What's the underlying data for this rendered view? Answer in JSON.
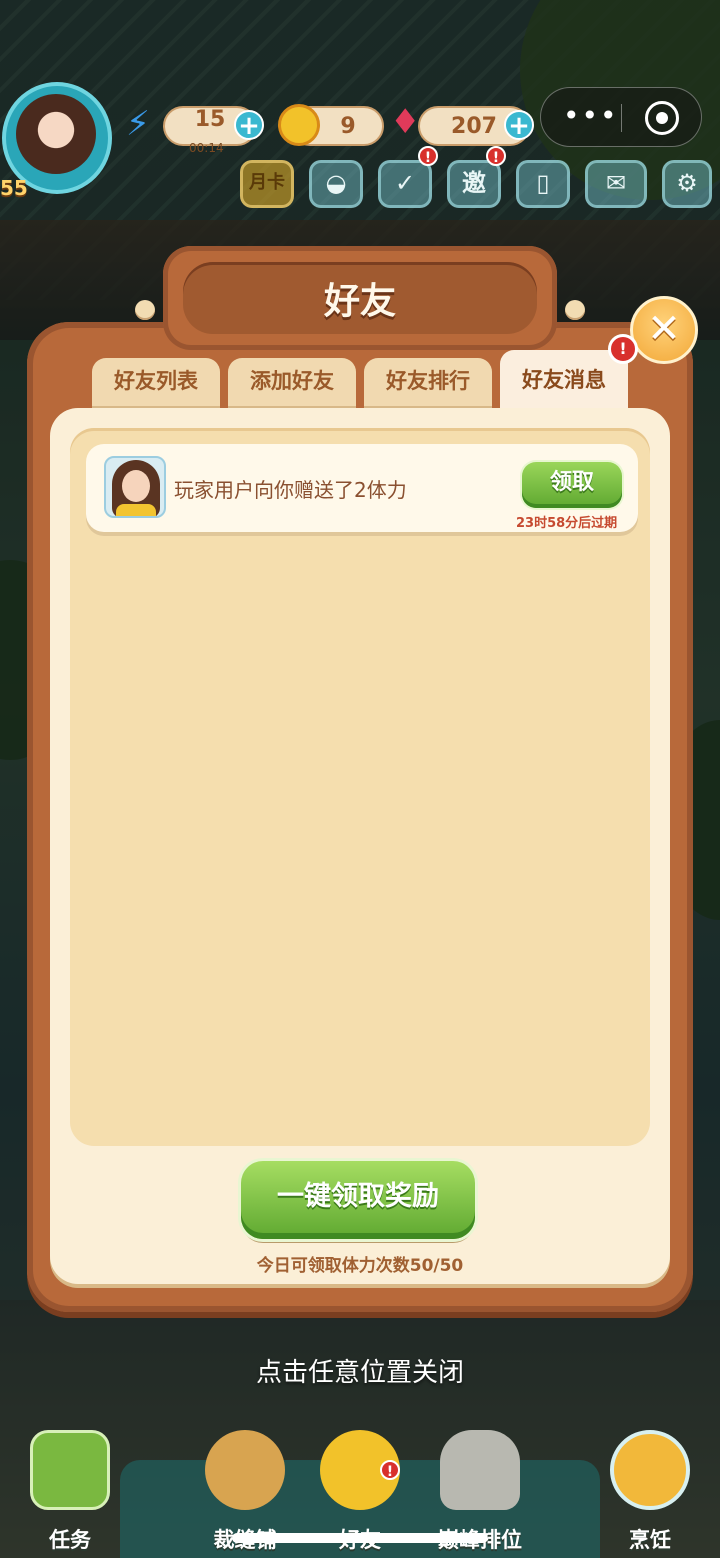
{
  "hud": {
    "player_level": "55",
    "energy": {
      "value": "15",
      "timer": "00:14",
      "plus": "+"
    },
    "coins": {
      "value": "9"
    },
    "gems": {
      "value": "207",
      "plus": "+"
    },
    "month_card_label": "月卡",
    "invite_label": "邀",
    "alert_glyph": "!",
    "capsule_menu": "•••"
  },
  "dialog": {
    "title": "好友",
    "tabs": [
      {
        "label": "好友列表",
        "active": false
      },
      {
        "label": "添加好友",
        "active": false
      },
      {
        "label": "好友排行",
        "active": false
      },
      {
        "label": "好友消息",
        "active": true
      }
    ],
    "messages": [
      {
        "text": "玩家用户向你赠送了2体力",
        "button": "领取",
        "expire": "23时58分后过期"
      }
    ],
    "claim_all_button": "一键领取奖励",
    "daily_limit": "今日可领取体力次数50/50",
    "close_glyph": "✕"
  },
  "tap_to_close": "点击任意位置关闭",
  "bottom_nav": [
    {
      "label": "任务"
    },
    {
      "label": "裁缝铺"
    },
    {
      "label": "好友"
    },
    {
      "label": "巅峰排位"
    },
    {
      "label": "烹饪"
    }
  ],
  "colors": {
    "panel_brown": "#b8693a",
    "panel_cream": "#fbefd7",
    "list_bg": "#f5deae",
    "green_button": "#5ea830",
    "badge_red": "#d8302c",
    "close_orange": "#f2a838"
  }
}
